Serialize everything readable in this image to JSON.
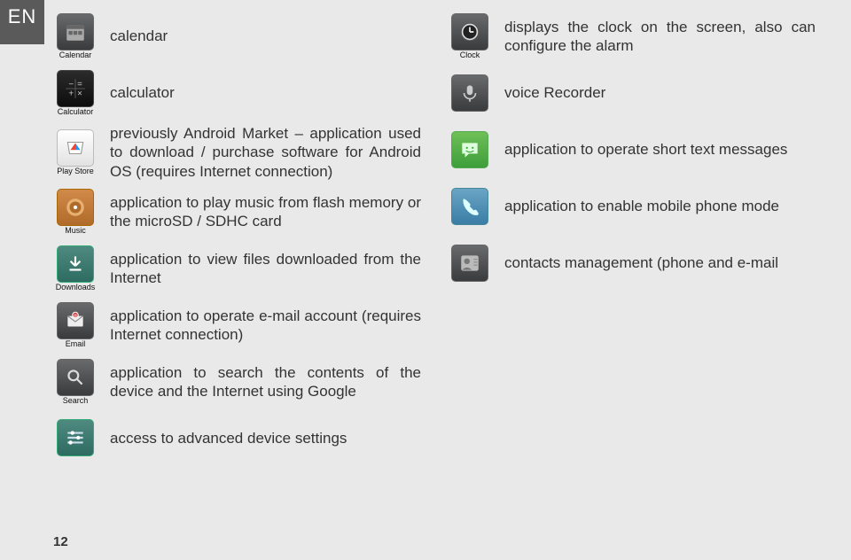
{
  "lang_badge": "EN",
  "page_number": "12",
  "left": [
    {
      "label": "Calendar",
      "desc": "calendar"
    },
    {
      "label": "Calculator",
      "desc": "calculator"
    },
    {
      "label": "Play Store",
      "desc": "previously Android Market – application used to download / purchase software for Android OS (requires Internet connection)"
    },
    {
      "label": "Music",
      "desc": "application to play music from flash memory or the microSD / SDHC card"
    },
    {
      "label": "Downloads",
      "desc": "application to view files downloaded from the Internet"
    },
    {
      "label": "Email",
      "desc": "application to operate e-mail account (requires Internet connection)"
    },
    {
      "label": "Search",
      "desc": "application to search the contents of the device and the Internet using Google"
    },
    {
      "label": "",
      "desc": "access to advanced device settings"
    }
  ],
  "right": [
    {
      "label": "Clock",
      "desc": "displays the clock on the screen, also can configure the alarm"
    },
    {
      "label": "",
      "desc": "voice Recorder"
    },
    {
      "label": "",
      "desc": "application to operate short text messages"
    },
    {
      "label": "",
      "desc": "application to enable mobile phone mode"
    },
    {
      "label": "",
      "desc": "contacts management (phone and e-mail"
    }
  ]
}
